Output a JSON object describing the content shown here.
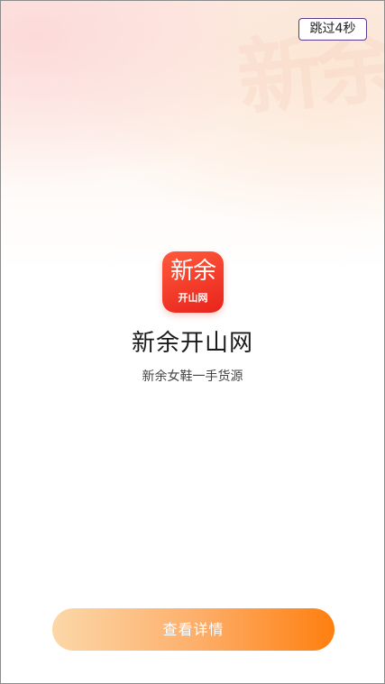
{
  "skip": {
    "label": "跳过4秒"
  },
  "logo": {
    "main_text": "新余",
    "sub_text": "开山网"
  },
  "watermark_text": "新余",
  "app": {
    "name": "新余开山网",
    "tagline": "新余女鞋一手货源"
  },
  "cta": {
    "label": "查看详情"
  },
  "colors": {
    "logo_red": "#e8231c",
    "cta_gradient_start": "#fcd7a8",
    "cta_gradient_end": "#fe7f0f",
    "skip_border": "#5a3b8c"
  }
}
